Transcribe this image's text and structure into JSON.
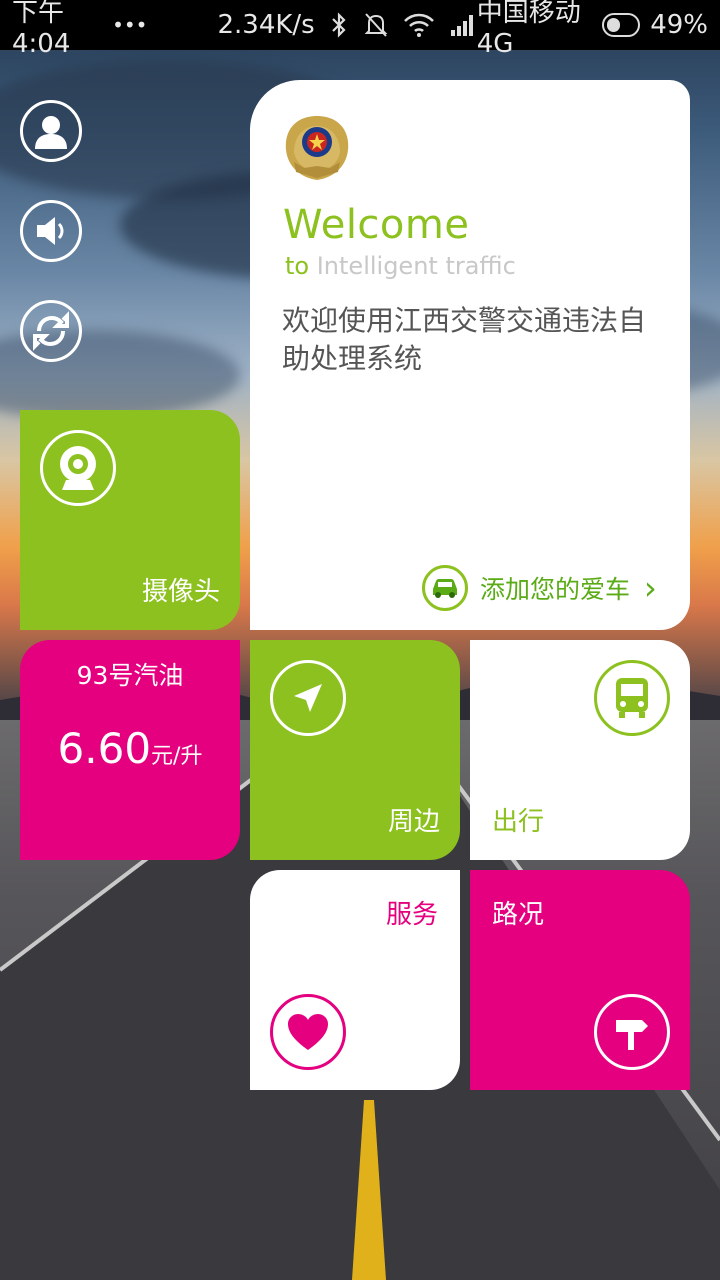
{
  "status_bar": {
    "time": "下午4:04",
    "dots": "•••",
    "speed": "2.34K/s",
    "carrier": "中国移动 4G",
    "battery": "49%",
    "battery_level": 0.49
  },
  "side_icons": [
    "user-icon",
    "volume-icon",
    "refresh-icon"
  ],
  "welcome": {
    "title": "Welcome",
    "sub_to": "to",
    "sub_rest": " Intelligent traffic",
    "description": "欢迎使用江西交警交通违法自助处理系统",
    "add_car_label": "添加您的爱车",
    "chevron": "›"
  },
  "tiles": {
    "camera": {
      "label": "摄像头"
    },
    "fuel": {
      "title": "93号汽油",
      "price": "6.60",
      "unit": "元/升"
    },
    "nearby": {
      "label": "周边"
    },
    "travel": {
      "label": "出行"
    },
    "service": {
      "label": "服务"
    },
    "traffic": {
      "label": "路况"
    }
  },
  "colors": {
    "green": "#8cc11f",
    "pink": "#e4007f",
    "white": "#ffffff"
  }
}
